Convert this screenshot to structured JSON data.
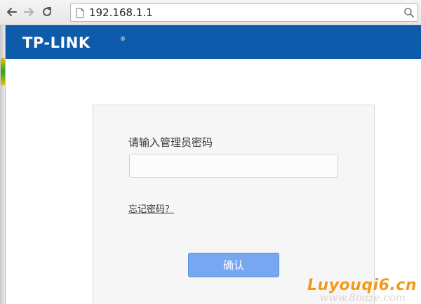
{
  "browser": {
    "url": "192.168.1.1",
    "icons": [
      "back-arrow-icon",
      "forward-arrow-icon",
      "reload-icon",
      "page-icon",
      "search-icon"
    ]
  },
  "header": {
    "logo": "TP-LINK",
    "logo_mark": "®",
    "background_color": "#0d5baa"
  },
  "login": {
    "prompt": "请输入管理员密码",
    "password_value": "",
    "forgot_password": "忘记密码？",
    "confirm_label": "确认",
    "button_color": "#76a7f0"
  },
  "watermark": {
    "main": "Luyouqi6.cn",
    "sub": "www.8oaze.com"
  }
}
